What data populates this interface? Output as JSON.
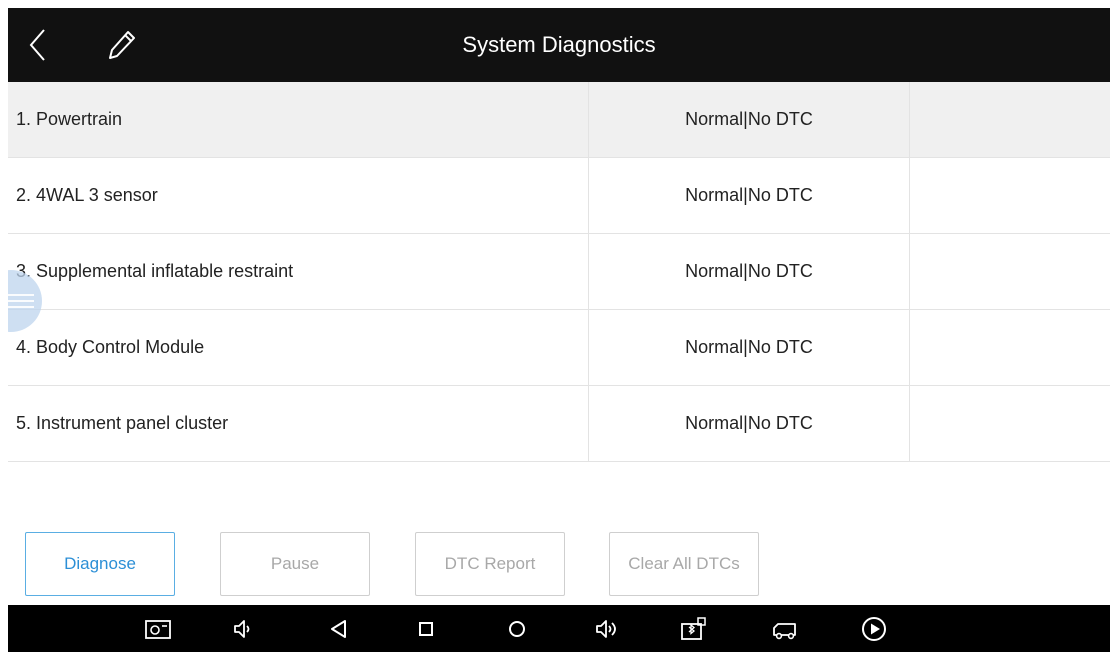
{
  "header": {
    "title": "System Diagnostics",
    "back_icon": "chevron-left-icon",
    "edit_icon": "pencil-icon"
  },
  "systems": [
    {
      "name": "1. Powertrain",
      "status": "Normal|No DTC",
      "selected": true
    },
    {
      "name": "2. 4WAL 3 sensor",
      "status": "Normal|No DTC",
      "selected": false
    },
    {
      "name": "3. Supplemental inflatable restraint",
      "status": "Normal|No DTC",
      "selected": false
    },
    {
      "name": "4. Body Control Module",
      "status": "Normal|No DTC",
      "selected": false
    },
    {
      "name": "5. Instrument panel cluster",
      "status": "Normal|No DTC",
      "selected": false
    }
  ],
  "actions": {
    "diagnose": "Diagnose",
    "pause": "Pause",
    "dtc_report": "DTC Report",
    "clear_all": "Clear All DTCs"
  },
  "navbar": {
    "icons": [
      "screenshot-icon",
      "volume-down-icon",
      "back-triangle-icon",
      "recents-square-icon",
      "home-circle-icon",
      "volume-up-icon",
      "vci-bluetooth-icon",
      "truck-icon",
      "play-icon"
    ]
  },
  "colors": {
    "header_bg": "#111111",
    "navbar_bg": "#000000",
    "primary_accent": "#2c8fd6",
    "selected_row_bg": "#f0f0f0"
  }
}
